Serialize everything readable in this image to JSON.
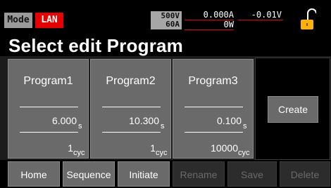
{
  "status": {
    "mode_label": "Mode",
    "lan_label": "LAN",
    "rated_voltage": "500V",
    "rated_current": "60A",
    "current": "0.000A",
    "voltage": "-0.01V",
    "power": "0W"
  },
  "title": "Select edit Program",
  "programs": [
    {
      "name": "Program1",
      "time": "6.000",
      "time_unit": "s",
      "cycles": "1",
      "cycle_unit": "cyc"
    },
    {
      "name": "Program2",
      "time": "10.300",
      "time_unit": "s",
      "cycles": "1",
      "cycle_unit": "cyc"
    },
    {
      "name": "Program3",
      "time": "0.100",
      "time_unit": "s",
      "cycles": "10000",
      "cycle_unit": "cyc"
    }
  ],
  "create_label": "Create",
  "menu": [
    {
      "label": "Home",
      "enabled": true
    },
    {
      "label": "Sequence",
      "enabled": true
    },
    {
      "label": "Initiate",
      "enabled": true
    },
    {
      "label": "Rename",
      "enabled": false
    },
    {
      "label": "Save",
      "enabled": false
    },
    {
      "label": "Delete",
      "enabled": false
    }
  ],
  "colors": {
    "accent_red": "#e60000",
    "lock_yellow": "#ffb300",
    "button_gray": "#6a6a6a"
  },
  "icons": {
    "lock": "lock-open-icon"
  }
}
